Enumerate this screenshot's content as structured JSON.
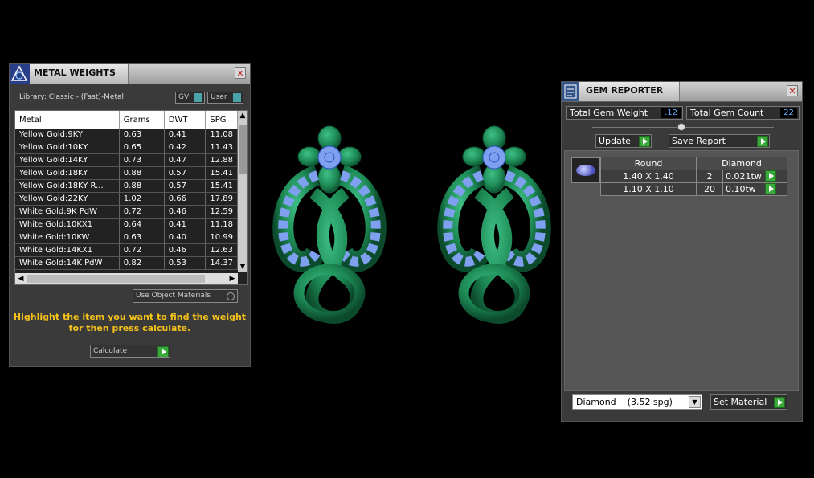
{
  "metal_panel": {
    "title": "METAL WEIGHTS",
    "library_label": "Library: Classic - (Fast)-Metal",
    "toggle_gv": "GV",
    "toggle_user": "User",
    "columns": [
      "Metal",
      "Grams",
      "DWT",
      "SPG"
    ],
    "rows": [
      [
        "Yellow Gold:9KY",
        "0.63",
        "0.41",
        "11.08"
      ],
      [
        "Yellow Gold:10KY",
        "0.65",
        "0.42",
        "11.43"
      ],
      [
        "Yellow Gold:14KY",
        "0.73",
        "0.47",
        "12.88"
      ],
      [
        "Yellow Gold:18KY",
        "0.88",
        "0.57",
        "15.41"
      ],
      [
        "Yellow Gold:18KY R...",
        "0.88",
        "0.57",
        "15.41"
      ],
      [
        "Yellow Gold:22KY",
        "1.02",
        "0.66",
        "17.89"
      ],
      [
        "White Gold:9K PdW",
        "0.72",
        "0.46",
        "12.59"
      ],
      [
        "White Gold:10KX1",
        "0.64",
        "0.41",
        "11.18"
      ],
      [
        "White Gold:10KW",
        "0.63",
        "0.40",
        "10.99"
      ],
      [
        "White Gold:14KX1",
        "0.72",
        "0.46",
        "12.63"
      ],
      [
        "White Gold:14K PdW",
        "0.82",
        "0.53",
        "14.37"
      ]
    ],
    "use_object_materials": "Use Object Materials",
    "hint_line1": "Highlight the item you want to find the weight",
    "hint_line2": "for then press calculate.",
    "calculate_label": "Calculate"
  },
  "gem_panel": {
    "title": "GEM REPORTER",
    "total_weight_label": "Total Gem Weight",
    "total_weight_value": ".12",
    "total_count_label": "Total Gem Count",
    "total_count_value": "22",
    "update_label": "Update",
    "save_report_label": "Save Report",
    "gem_shape": "Round",
    "gem_type": "Diamond",
    "gem_rows": [
      [
        "1.40 X 1.40",
        "2",
        "0.021tw"
      ],
      [
        "1.10 X 1.10",
        "20",
        "0.10tw"
      ]
    ],
    "material_select": "Diamond    (3.52 spg)",
    "set_material_label": "Set Material"
  },
  "colors": {
    "metal_green": "#1f8a55",
    "gem_blue": "#7fa0ee",
    "hint_yellow": "#f4c21a",
    "arrow_green": "#3aa83a"
  }
}
